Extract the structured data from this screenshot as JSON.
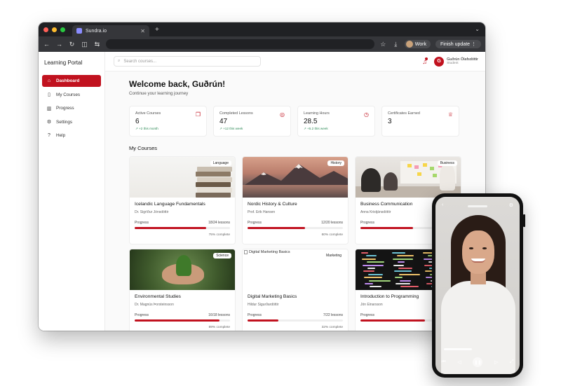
{
  "browser": {
    "tab_title": "Sundra.io",
    "new_tab": "+",
    "profile_label": "Work",
    "finish_update": "Finish update"
  },
  "app": {
    "brand": "Learning Portal",
    "search_placeholder": "Search courses...",
    "user": {
      "name": "Guðrún Ólafsdóttir",
      "role": "Student",
      "initial": "G"
    }
  },
  "sidebar": {
    "items": [
      {
        "label": "Dashboard",
        "icon": "home-icon",
        "glyph": "⌂",
        "active": true
      },
      {
        "label": "My Courses",
        "icon": "book-icon",
        "glyph": "▯",
        "active": false
      },
      {
        "label": "Progress",
        "icon": "chart-icon",
        "glyph": "▥",
        "active": false
      },
      {
        "label": "Settings",
        "icon": "gear-icon",
        "glyph": "⚙",
        "active": false
      },
      {
        "label": "Help",
        "icon": "help-icon",
        "glyph": "?",
        "active": false
      }
    ]
  },
  "main": {
    "welcome": "Welcome back, Guðrún!",
    "subtitle": "Continue your learning journey",
    "section_title": "My Courses"
  },
  "stats": [
    {
      "label": "Active Courses",
      "value": "6",
      "delta": "↗ +2 this month",
      "icon": "book-open-icon",
      "glyph": "❐"
    },
    {
      "label": "Completed Lessons",
      "value": "47",
      "delta": "↗ +12 this week",
      "icon": "check-circle-icon",
      "glyph": "◎"
    },
    {
      "label": "Learning Hours",
      "value": "28.5",
      "delta": "↗ +5.2 this week",
      "icon": "clock-icon",
      "glyph": "◷"
    },
    {
      "label": "Certificates Earned",
      "value": "3",
      "delta": "",
      "icon": "trophy-icon",
      "glyph": "♕"
    }
  ],
  "courses": [
    {
      "title": "Icelandic Language Fundamentals",
      "instructor": "Dr. Sigríður Jónsdóttir",
      "tag": "Language",
      "progress_label": "Progress",
      "lessons": "18/24 lessons",
      "complete": "75% complete",
      "progress": 0.75
    },
    {
      "title": "Nordic History & Culture",
      "instructor": "Prof. Erik Hansen",
      "tag": "History",
      "progress_label": "Progress",
      "lessons": "12/20 lessons",
      "complete": "60% complete",
      "progress": 0.6
    },
    {
      "title": "Business Communication",
      "instructor": "Anna Kristjánsdóttir",
      "tag": "Business",
      "progress_label": "Progress",
      "lessons": "",
      "complete": "",
      "progress": 0.55
    },
    {
      "title": "Environmental Studies",
      "instructor": "Dr. Magnús Þorsteinsson",
      "tag": "Science",
      "progress_label": "Progress",
      "lessons": "16/18 lessons",
      "complete": "89% complete",
      "progress": 0.89
    },
    {
      "title": "Digital Marketing Basics",
      "instructor": "Hildur Sigurðardóttir",
      "tag": "Marketing",
      "alt": "Digital Marketing Basics",
      "progress_label": "Progress",
      "lessons": "7/22 lessons",
      "complete": "32% complete",
      "progress": 0.32
    },
    {
      "title": "Introduction to Programming",
      "instructor": "Jón Einarsson",
      "tag": "",
      "progress_label": "Progress",
      "lessons": "",
      "complete": "",
      "progress": 0.68
    }
  ],
  "colors": {
    "accent": "#c1121f",
    "positive": "#2e8b57"
  }
}
